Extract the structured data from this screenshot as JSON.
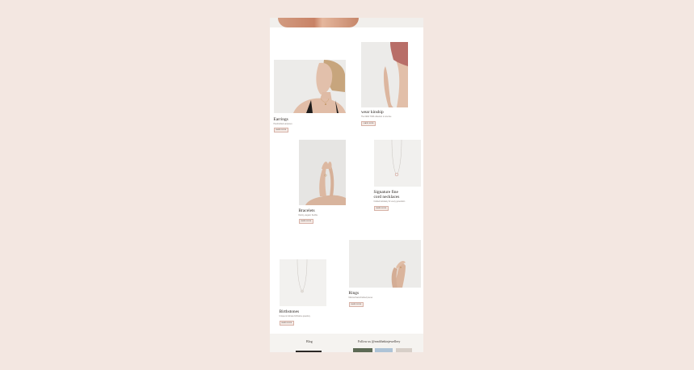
{
  "products": {
    "earrings": {
      "title": "Earrings",
      "desc": "Handcrafted earpieces",
      "button": "Learn more"
    },
    "wear": {
      "title": "wear kinship",
      "desc": "The NEW TORI collection is now live",
      "button": "Learn more"
    },
    "bracelets": {
      "title": "Bracelets",
      "desc": "Dainty, elegant, flexible",
      "button": "Learn more"
    },
    "signature": {
      "title_line1": "Signature fine",
      "title_line2": "cord necklaces",
      "desc": "Crafted delicately for every generation",
      "button": "Learn more"
    },
    "rings": {
      "title": "Rings",
      "desc": "Minimal hand-finished pieces",
      "button": "Learn more"
    },
    "birthstones": {
      "title": "Birthstones",
      "desc": "Unique & intimate birthstone jewellery",
      "button": "Learn more"
    }
  },
  "footer": {
    "blog_label": "Blog",
    "follow_label": "Follow us @readthekinjewellery"
  },
  "colors": {
    "page_bg": "#f3e7e1",
    "button_border": "#d7b2a7",
    "button_bg": "#f5ebe6"
  }
}
